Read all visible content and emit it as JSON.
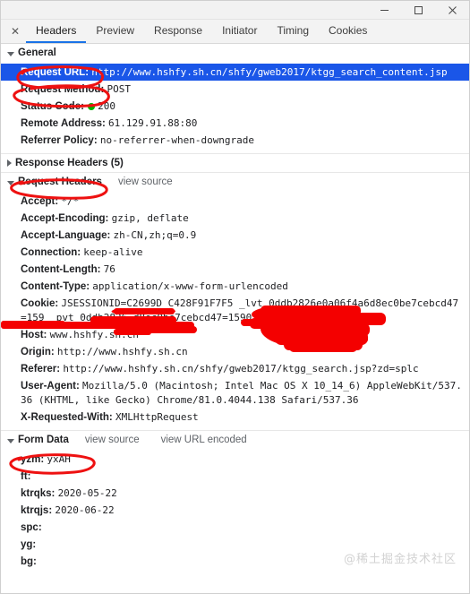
{
  "window": {
    "minimize_label": "minimize-window",
    "maximize_label": "maximize-window",
    "close_label": "close-window"
  },
  "tabbar": {
    "close_glyph": "✕",
    "tabs": [
      {
        "label": "Headers",
        "active": true
      },
      {
        "label": "Preview",
        "active": false
      },
      {
        "label": "Response",
        "active": false
      },
      {
        "label": "Initiator",
        "active": false
      },
      {
        "label": "Timing",
        "active": false
      },
      {
        "label": "Cookies",
        "active": false
      }
    ]
  },
  "general": {
    "title": "General",
    "rows": [
      {
        "key": "Request URL:",
        "value": "http://www.hshfy.sh.cn/shfy/gweb2017/ktgg_search_content.jsp",
        "selected": true
      },
      {
        "key": "Request Method:",
        "value": "POST",
        "selected": false
      },
      {
        "key": "Status Code:",
        "value": "200",
        "status_dot": true,
        "selected": false
      },
      {
        "key": "Remote Address:",
        "value": "61.129.91.88:80",
        "selected": false
      },
      {
        "key": "Referrer Policy:",
        "value": "no-referrer-when-downgrade",
        "selected": false
      }
    ]
  },
  "response_headers": {
    "title": "Response Headers (5)"
  },
  "request_headers": {
    "title": "Request Headers",
    "view_source_label": "view source",
    "rows": [
      {
        "key": "Accept:",
        "value": "*/*"
      },
      {
        "key": "Accept-Encoding:",
        "value": "gzip, deflate"
      },
      {
        "key": "Accept-Language:",
        "value": "zh-CN,zh;q=0.9"
      },
      {
        "key": "Connection:",
        "value": "keep-alive"
      },
      {
        "key": "Content-Length:",
        "value": "76"
      },
      {
        "key": "Content-Type:",
        "value": "application/x-www-form-urlencoded"
      },
      {
        "key": "Cookie:",
        "value": "JSESSIONID=C2699D                    C428F91F7F5                    _lvt_0ddb2826e0a06f4a6d8ec0be7cebcd47=159                    _pvt_0ddb2826             d8ec0be7cebcd47=1590106225"
      },
      {
        "key": "Host:",
        "value": "www.hshfy.sh.cn"
      },
      {
        "key": "Origin:",
        "value": "http://www.hshfy.sh.cn"
      },
      {
        "key": "Referer:",
        "value": "http://www.hshfy.sh.cn/shfy/gweb2017/ktgg_search.jsp?zd=splc"
      },
      {
        "key": "User-Agent:",
        "value": "Mozilla/5.0 (Macintosh; Intel Mac OS X 10_14_6) AppleWebKit/537.36 (KHTML, like Gecko) Chrome/81.0.4044.138 Safari/537.36"
      },
      {
        "key": "X-Requested-With:",
        "value": "XMLHttpRequest"
      }
    ]
  },
  "form_data": {
    "title": "Form Data",
    "view_source_label": "view source",
    "view_url_encoded_label": "view URL encoded",
    "rows": [
      {
        "key": "yzm:",
        "value": "yxAH"
      },
      {
        "key": "ft:",
        "value": ""
      },
      {
        "key": "ktrqks:",
        "value": "2020-05-22"
      },
      {
        "key": "ktrqjs:",
        "value": "2020-06-22"
      },
      {
        "key": "spc:",
        "value": ""
      },
      {
        "key": "yg:",
        "value": ""
      },
      {
        "key": "bg:",
        "value": ""
      }
    ]
  },
  "watermark": {
    "text": "@稀土掘金技术社区"
  },
  "colors": {
    "selection_blue": "#1a56e8",
    "tab_accent": "#1a73e8",
    "status_green": "#00b300",
    "annotation_red": "#ee1111"
  }
}
